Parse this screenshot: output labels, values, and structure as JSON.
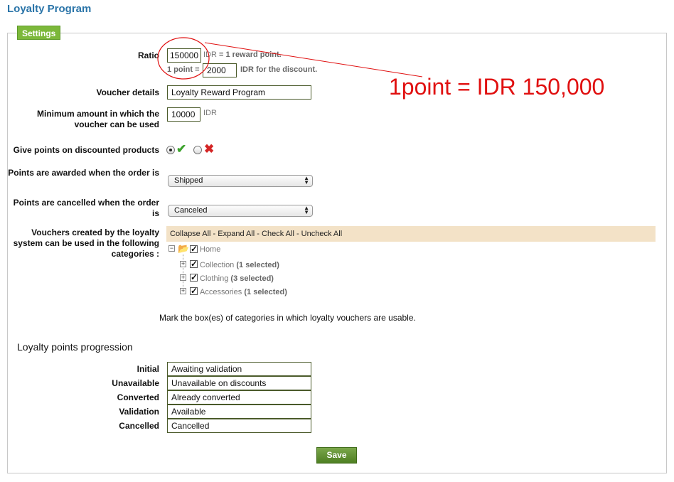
{
  "page_title": "Loyalty Program",
  "settings_legend": "Settings",
  "ratio": {
    "label": "Ratio",
    "value": "150000",
    "after_text": "IDR",
    "after_bold": " = 1 reward point.",
    "point_prefix": "1 point =",
    "point_value": "2000",
    "point_suffix": "IDR for the discount."
  },
  "voucher_details": {
    "label": "Voucher details",
    "value": "Loyalty Reward Program"
  },
  "minimum_amount": {
    "label": "Minimum amount in which the voucher can be used",
    "value": "10000",
    "unit": "IDR"
  },
  "give_points": {
    "label": "Give points on discounted products",
    "selected": "yes"
  },
  "points_awarded": {
    "label": "Points are awarded when the order is",
    "selected": "Shipped"
  },
  "points_cancelled": {
    "label": "Points are cancelled when the order is",
    "selected": "Canceled"
  },
  "categories": {
    "label": "Vouchers created by the loyalty system can be used in the following categories :",
    "toolbar": [
      "Collapse All",
      "Expand All",
      "Check All",
      "Uncheck All"
    ],
    "toolbar_sep": " - ",
    "root": "Home",
    "children": [
      {
        "name": "Collection",
        "selected": "(1 selected)"
      },
      {
        "name": "Clothing",
        "selected": "(3 selected)"
      },
      {
        "name": "Accessories",
        "selected": "(1 selected)"
      }
    ],
    "help": "Mark the box(es) of categories in which loyalty vouchers are usable."
  },
  "progression": {
    "heading": "Loyalty points progression",
    "rows": [
      {
        "label": "Initial",
        "value": "Awaiting validation"
      },
      {
        "label": "Unavailable",
        "value": "Unavailable on discounts"
      },
      {
        "label": "Converted",
        "value": "Already converted"
      },
      {
        "label": "Validation",
        "value": "Available"
      },
      {
        "label": "Cancelled",
        "value": "Cancelled"
      }
    ]
  },
  "save_label": "Save",
  "annotation": "1point = IDR 150,000",
  "colors": {
    "title": "#2a74a8",
    "legend_bg": "#7cb83a",
    "toolbar_bg": "#f3e2c7",
    "annotation": "#e01010",
    "save_bg": "#5d8f2e"
  }
}
